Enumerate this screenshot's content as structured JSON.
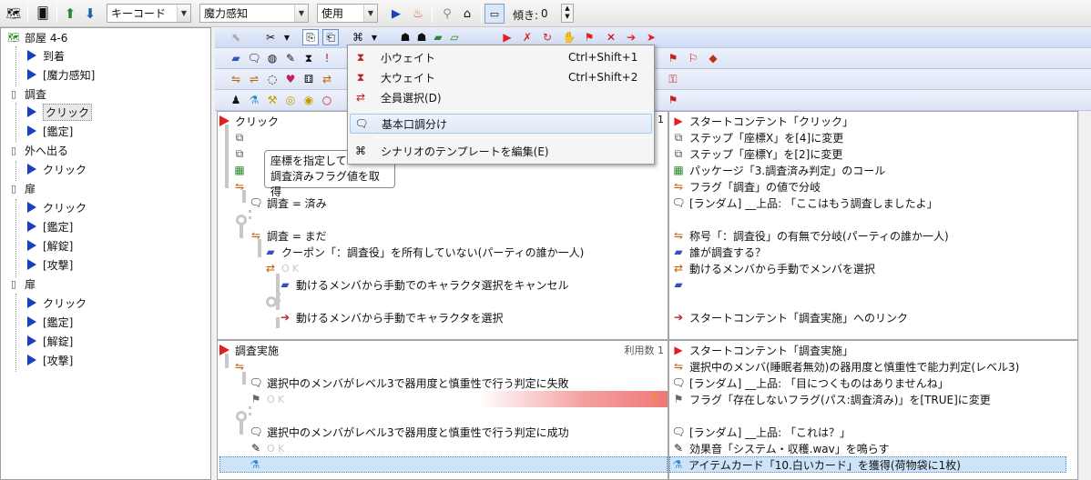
{
  "toolbar": {
    "key_combo": "キーコード",
    "skill_combo": "魔力感知",
    "use_combo": "使用",
    "tilt_label": "傾き:",
    "tilt_value": "0"
  },
  "tree": {
    "items": [
      {
        "label": "部屋 4-6",
        "level": 0,
        "icon": "map-icon"
      },
      {
        "label": "到着",
        "level": 1,
        "icon": "event-arrow-icon"
      },
      {
        "label": "[魔力感知]",
        "level": 1,
        "icon": "event-arrow-icon"
      },
      {
        "label": "調査",
        "level": 0,
        "icon": "card-icon"
      },
      {
        "label": "クリック",
        "level": 1,
        "icon": "event-arrow-icon",
        "selected": true
      },
      {
        "label": "[鑑定]",
        "level": 1,
        "icon": "event-arrow-icon"
      },
      {
        "label": "外へ出る",
        "level": 0,
        "icon": "card-icon"
      },
      {
        "label": "クリック",
        "level": 1,
        "icon": "event-arrow-icon"
      },
      {
        "label": "扉",
        "level": 0,
        "icon": "card-icon"
      },
      {
        "label": "クリック",
        "level": 1,
        "icon": "event-arrow-icon"
      },
      {
        "label": "[鑑定]",
        "level": 1,
        "icon": "event-arrow-icon"
      },
      {
        "label": "[解錠]",
        "level": 1,
        "icon": "event-arrow-icon"
      },
      {
        "label": "[攻撃]",
        "level": 1,
        "icon": "event-arrow-icon"
      },
      {
        "label": "扉",
        "level": 0,
        "icon": "card-icon"
      },
      {
        "label": "クリック",
        "level": 1,
        "icon": "event-arrow-icon"
      },
      {
        "label": "[鑑定]",
        "level": 1,
        "icon": "event-arrow-icon"
      },
      {
        "label": "[解錠]",
        "level": 1,
        "icon": "event-arrow-icon"
      },
      {
        "label": "[攻撃]",
        "level": 1,
        "icon": "event-arrow-icon"
      }
    ]
  },
  "menu": {
    "items": [
      {
        "label": "小ウェイト",
        "shortcut": "Ctrl+Shift+1",
        "icon": "hourglass-icon"
      },
      {
        "label": "大ウェイト",
        "shortcut": "Ctrl+Shift+2",
        "icon": "hourglass-icon"
      },
      {
        "label": "全員選択(D)",
        "shortcut": "",
        "icon": "select-all-icon"
      },
      {
        "label": "基本口調分け",
        "shortcut": "",
        "icon": "speech-bubble-icon",
        "highlighted": true
      },
      {
        "label": "シナリオのテンプレートを編集(E)",
        "shortcut": "",
        "icon": "template-icon"
      }
    ]
  },
  "tooltip": {
    "line1": "座標を指定して",
    "line2": "調査済みフラグ値を取得"
  },
  "content1": {
    "title": "クリック",
    "count": "1",
    "ok": "O K",
    "tree_rows": [
      "調査 = 済み",
      "調査 = まだ",
      "クーポン「：調査役」を所有していない(パーティの誰か一人)",
      "動けるメンバから手動でのキャラクタ選択をキャンセル",
      "動けるメンバから手動でキャラクタを選択"
    ],
    "desc": [
      "スタートコンテント「クリック」",
      "ステップ「座標X」を[4]に変更",
      "ステップ「座標Y」を[2]に変更",
      "パッケージ「3.調査済み判定」のコール",
      "フラグ「調査」の値で分岐",
      "[ランダム] __上品: 「ここはもう調査しましたよ」",
      "称号「：調査役」の有無で分岐(パーティの誰か一人)",
      "誰が調査する？",
      "動けるメンバから手動でメンバを選択",
      "スタートコンテント「調査実施」へのリンク"
    ]
  },
  "content2": {
    "title": "調査実施",
    "count_label": "利用数 1",
    "ok": "O K",
    "tree_rows": [
      "選択中のメンバがレベル3で器用度と慎重性で行う判定に失敗",
      "選択中のメンバがレベル3で器用度と慎重性で行う判定に成功"
    ],
    "desc": [
      "スタートコンテント「調査実施」",
      "選択中のメンバ(睡眠者無効)の器用度と慎重性で能力判定(レベル3)",
      "[ランダム] __上品: 「目につくものはありませんね」",
      "フラグ「存在しないフラグ(パス:調査済み)」を[TRUE]に変更",
      "[ランダム] __上品: 「これは？」",
      "効果音「システム・収穫.wav」を鳴らす",
      "アイテムカード「10.白いカード」を獲得(荷物袋に1枚)"
    ]
  },
  "colors": {
    "accent_blue": "#1a3fbf",
    "start_red": "#e02020",
    "warning_gradient_end": "#f07878"
  }
}
